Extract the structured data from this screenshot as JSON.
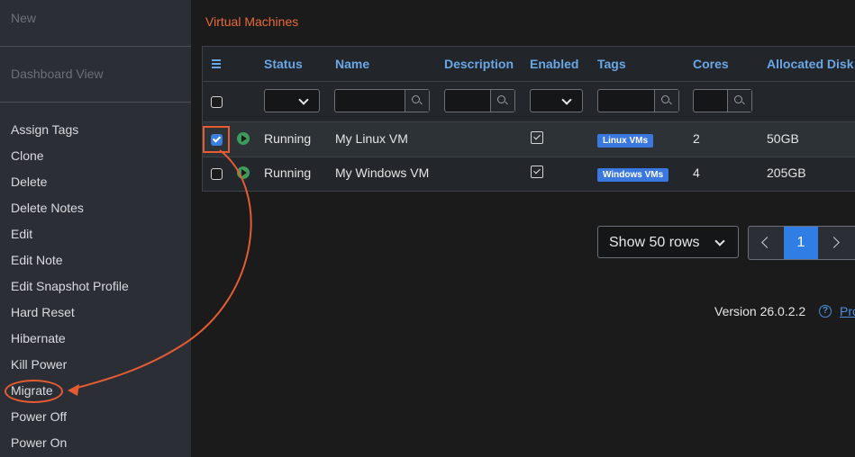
{
  "sidebar": {
    "new_label": "New",
    "dashboard_label": "Dashboard View",
    "items": [
      "Assign Tags",
      "Clone",
      "Delete",
      "Delete Notes",
      "Edit",
      "Edit Note",
      "Edit Snapshot Profile",
      "Hard Reset",
      "Hibernate",
      "Kill Power",
      "Migrate",
      "Power Off",
      "Power On"
    ]
  },
  "page": {
    "title": "Virtual Machines"
  },
  "table": {
    "columns": [
      "Status",
      "Name",
      "Description",
      "Enabled",
      "Tags",
      "Cores",
      "Allocated Disk"
    ],
    "rows": [
      {
        "status": "Running",
        "name": "My Linux VM",
        "description": "",
        "enabled": true,
        "tag": "Linux VMs",
        "cores": "2",
        "disk": "50GB",
        "selected": true
      },
      {
        "status": "Running",
        "name": "My Windows VM",
        "description": "",
        "enabled": true,
        "tag": "Windows VMs",
        "cores": "4",
        "disk": "205GB",
        "selected": false
      }
    ]
  },
  "pagination": {
    "rows_label": "Show 50 rows",
    "current_page": "1"
  },
  "footer": {
    "version": "Version 26.0.2.2",
    "help_link": "Pro",
    "help_glyph": "?"
  },
  "colors": {
    "accent": "#e86a3a",
    "header_text": "#6aa7e6",
    "tag_bg": "#3a78e0",
    "annotation": "#e55b34"
  },
  "icons": [
    "menu-icon",
    "chevron-down-icon",
    "search-icon",
    "play-icon",
    "chevron-left-icon",
    "chevron-right-icon",
    "help-icon"
  ]
}
